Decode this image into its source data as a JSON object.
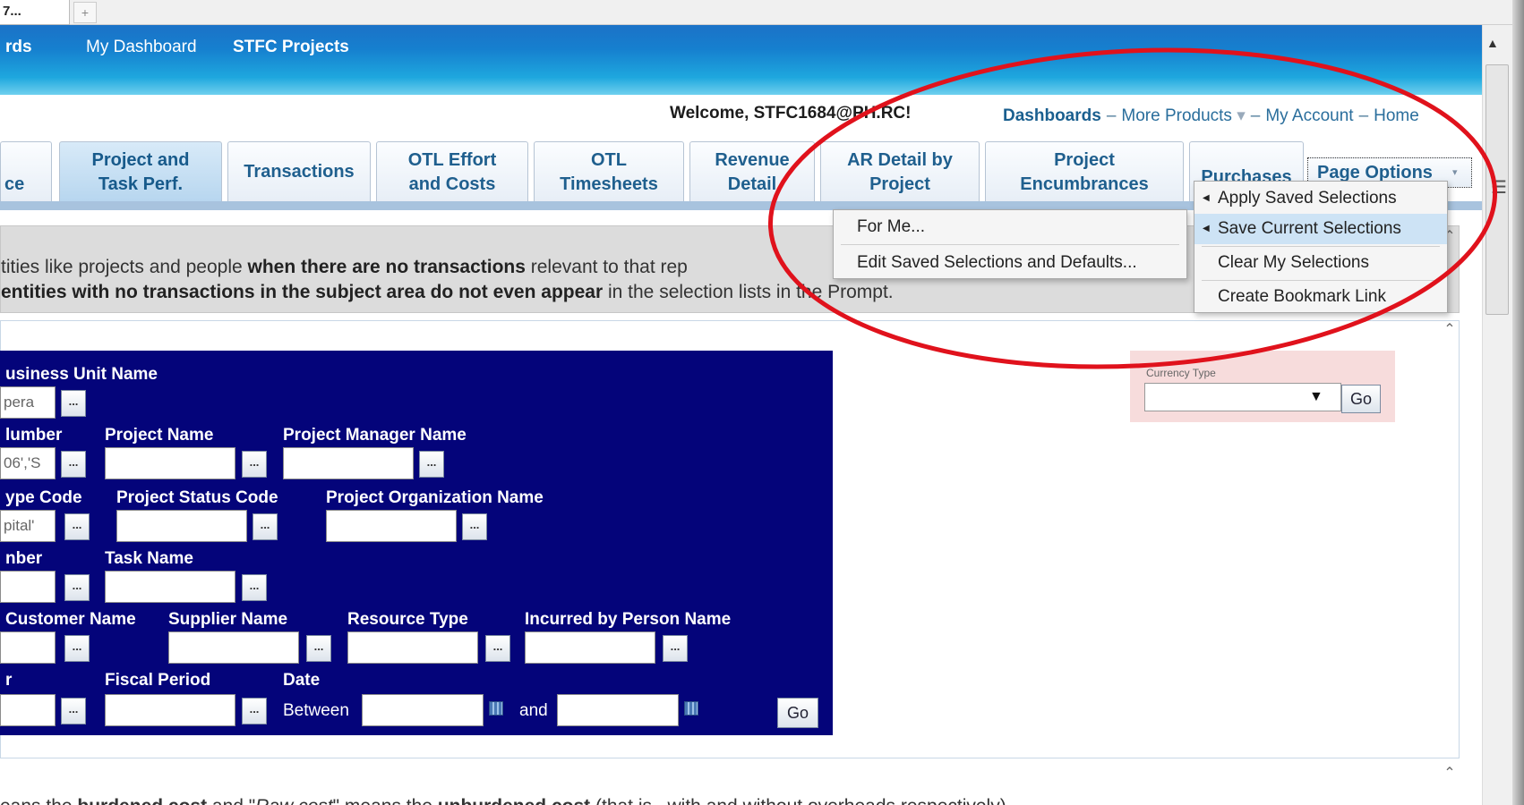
{
  "browser_tab": {
    "label": "7...",
    "new_tab_glyph": "+"
  },
  "topnav": {
    "items": [
      "rds",
      "My Dashboard",
      "STFC Projects"
    ]
  },
  "welcome": "Welcome, STFC1684@PH.RC!",
  "toplinks": {
    "dashboards": "Dashboards",
    "more_products": "More Products",
    "my_account": "My Account",
    "home": "Home",
    "separator": "–",
    "caret": "▾"
  },
  "tabs": [
    {
      "line1": "",
      "line2": "ce"
    },
    {
      "line1": "Project and",
      "line2": "Task Perf."
    },
    {
      "line1": "Transactions",
      "line2": ""
    },
    {
      "line1": "OTL Effort",
      "line2": "and Costs"
    },
    {
      "line1": "OTL",
      "line2": "Timesheets"
    },
    {
      "line1": "Revenue",
      "line2": "Detail"
    },
    {
      "line1": "AR Detail by",
      "line2": "Project"
    },
    {
      "line1": "Project",
      "line2": "Encumbrances"
    },
    {
      "line1": "Purchases",
      "line2": ""
    }
  ],
  "page_options": {
    "label": "Page Options",
    "caret": "▾"
  },
  "menu_main": [
    {
      "label": "Apply Saved Selections",
      "has_submenu": true
    },
    {
      "label": "Save Current Selections",
      "has_submenu": true,
      "highlighted": true
    },
    {
      "label": "Clear My Selections"
    },
    {
      "label": "Create Bookmark Link"
    }
  ],
  "menu_sub": [
    {
      "label": "For Me..."
    },
    {
      "label": "Edit Saved Selections and Defaults..."
    }
  ],
  "info": {
    "line1_a": "tities like projects and people ",
    "line1_b": "when there are no transactions",
    "line1_c": " relevant to that rep",
    "line2_a": "entities with no transactions in the subject area do not even appear",
    "line2_b": " in the selection lists in the Prompt."
  },
  "prompt": {
    "labels": {
      "business_unit_name": "usiness Unit Name",
      "project_number": "lumber",
      "project_name": "Project Name",
      "project_manager_name": "Project Manager Name",
      "project_type_code": "ype Code",
      "project_status_code": "Project Status Code",
      "project_org_name": "Project Organization Name",
      "task_number": "nber",
      "task_name": "Task Name",
      "customer_name": "Customer Name",
      "supplier_name": "Supplier Name",
      "resource_type": "Resource Type",
      "incurred_by": "Incurred by Person Name",
      "fiscal_year": "r",
      "fiscal_period": "Fiscal Period",
      "date": "Date",
      "between": "Between",
      "and": "and"
    },
    "values": {
      "business_unit_name": "pera",
      "project_number": "06','S",
      "project_type_code": "pital'",
      "project_name": "",
      "project_manager_name": "",
      "project_status_code": "",
      "project_org_name": "",
      "task_number": "",
      "task_name": "",
      "customer_name": "",
      "supplier_name": "",
      "resource_type": "",
      "incurred_by": "",
      "fiscal_year": "",
      "fiscal_period": "",
      "date_from": "",
      "date_to": ""
    },
    "browse_glyph": "...",
    "go_label": "Go"
  },
  "currency": {
    "label": "Currency Type",
    "value": "",
    "go_label": "Go"
  },
  "bottom": {
    "a": "eans the ",
    "b": "burdened cost",
    "c": " and \"",
    "d": "Raw cost",
    "e": "\" means the ",
    "f": "unburdened cost",
    "g": " (that is , with and without overheads respectively)"
  },
  "colors": {
    "annotation": "#e0121c",
    "prompt_bg": "#04047a",
    "topbar": "#1680cf",
    "link": "#2a6e9c"
  }
}
